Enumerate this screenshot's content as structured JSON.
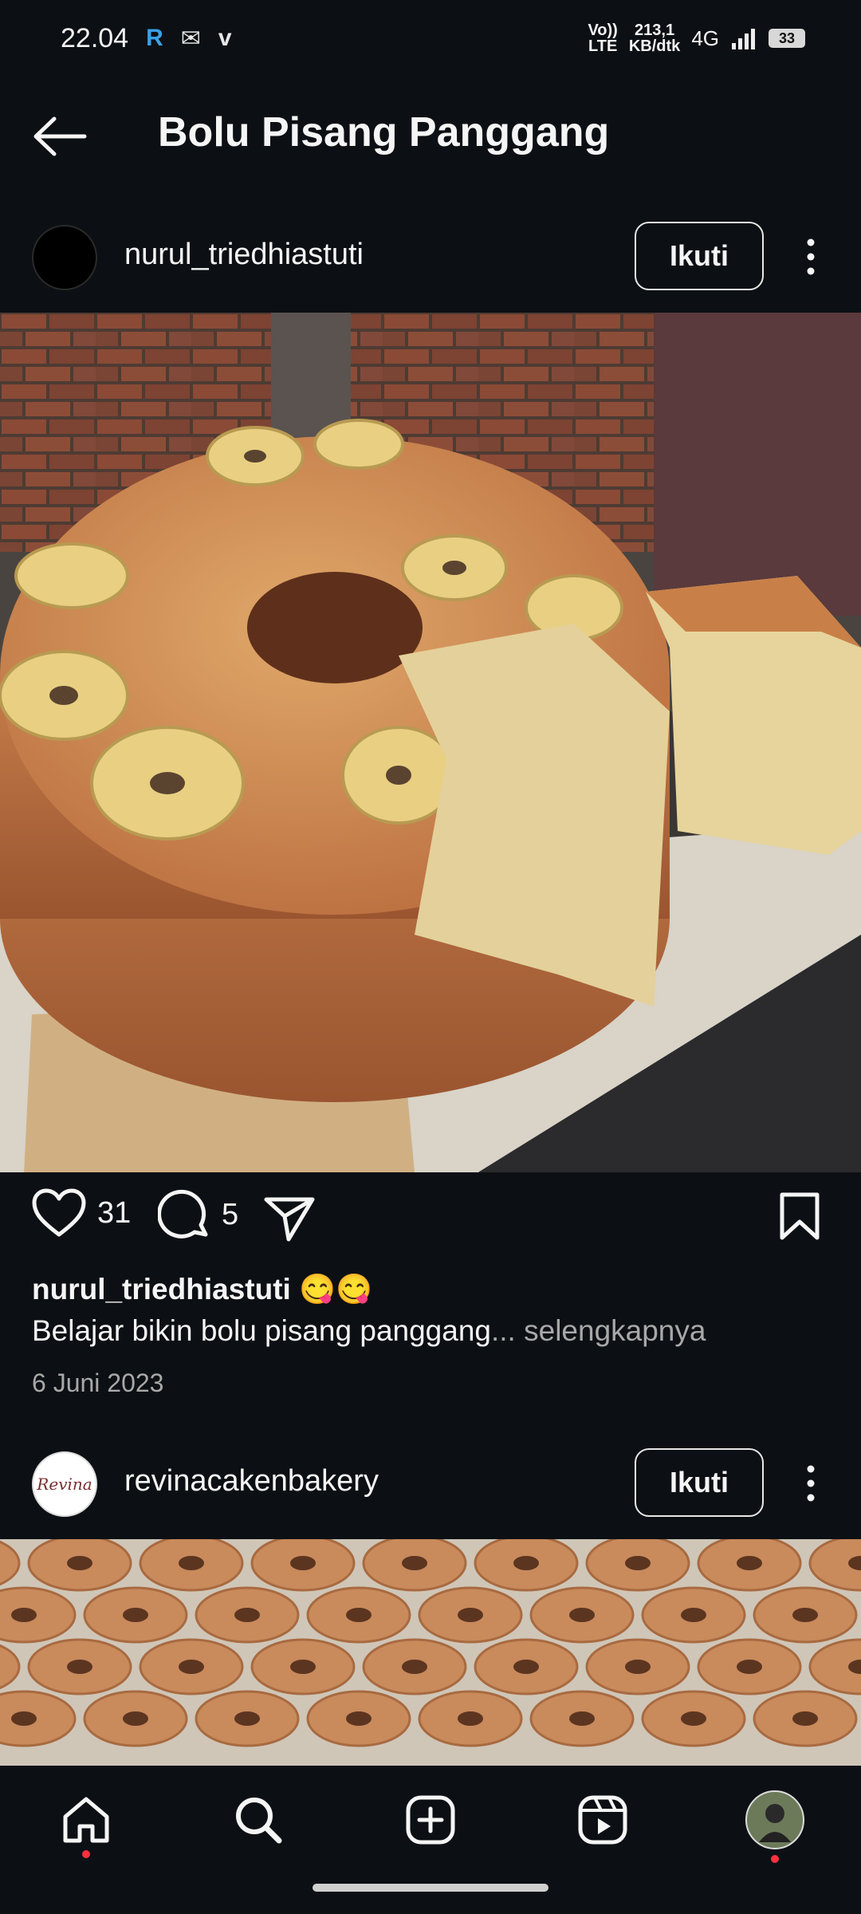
{
  "status_bar": {
    "time": "22.04",
    "network_top": "Vo))",
    "network_bottom": "LTE",
    "speed_value": "213,1",
    "speed_unit": "KB/dtk",
    "network_type": "4G",
    "battery": "33"
  },
  "header": {
    "title": "Bolu Pisang Panggang"
  },
  "post1": {
    "username": "nurul_triedhiastuti",
    "follow_label": "Ikuti",
    "likes": "31",
    "comments": "5",
    "caption_user": "nurul_triedhiastuti 😋😋",
    "caption_text": "Belajar bikin bolu pisang panggang",
    "caption_more": "... selengkapnya",
    "date": "6 Juni 2023"
  },
  "post2": {
    "username": "revinacakenbakery",
    "follow_label": "Ikuti",
    "avatar_text": "Revina"
  },
  "nav": {
    "items": [
      "home-icon",
      "search-icon",
      "create-icon",
      "reels-icon",
      "profile-avatar"
    ]
  },
  "colors": {
    "background": "#0c1014",
    "text": "#f5f5f5",
    "muted": "#a8a8a8",
    "notification_dot": "#ff3040"
  }
}
